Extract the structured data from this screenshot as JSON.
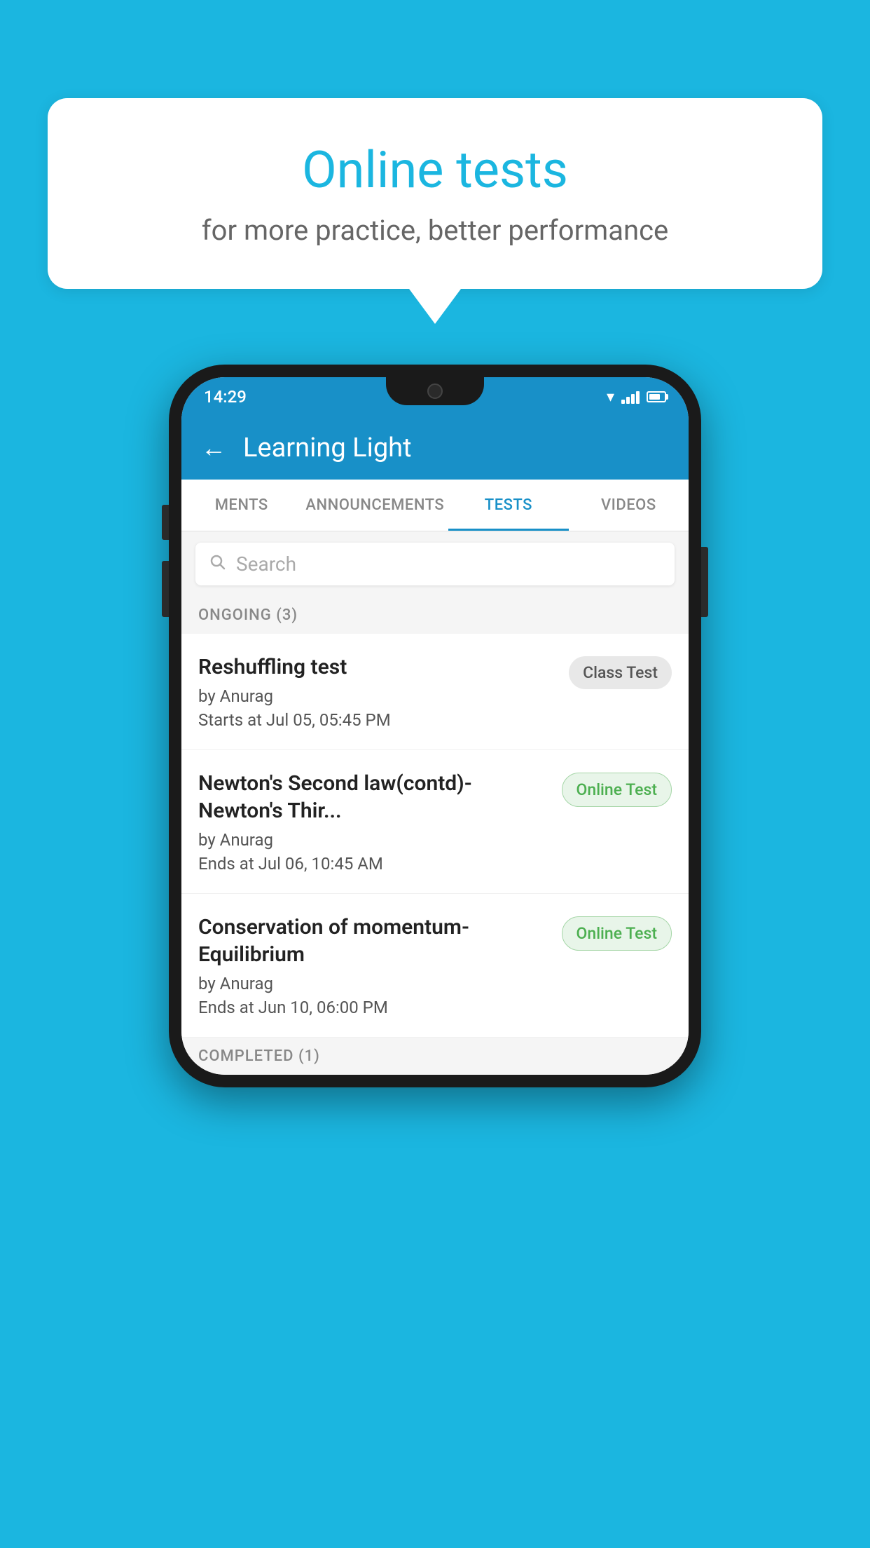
{
  "background_color": "#1BB6E0",
  "bubble": {
    "title": "Online tests",
    "subtitle": "for more practice, better performance"
  },
  "phone": {
    "status_bar": {
      "time": "14:29"
    },
    "header": {
      "title": "Learning Light",
      "back_label": "←"
    },
    "tabs": [
      {
        "id": "ments",
        "label": "MENTS",
        "active": false
      },
      {
        "id": "announcements",
        "label": "ANNOUNCEMENTS",
        "active": false
      },
      {
        "id": "tests",
        "label": "TESTS",
        "active": true
      },
      {
        "id": "videos",
        "label": "VIDEOS",
        "active": false
      }
    ],
    "search": {
      "placeholder": "Search"
    },
    "ongoing_section": {
      "label": "ONGOING (3)"
    },
    "tests": [
      {
        "id": 1,
        "title": "Reshuffling test",
        "author": "by Anurag",
        "date": "Starts at  Jul 05, 05:45 PM",
        "badge": "Class Test",
        "badge_type": "class"
      },
      {
        "id": 2,
        "title": "Newton's Second law(contd)-Newton's Thir...",
        "author": "by Anurag",
        "date": "Ends at  Jul 06, 10:45 AM",
        "badge": "Online Test",
        "badge_type": "online"
      },
      {
        "id": 3,
        "title": "Conservation of momentum-Equilibrium",
        "author": "by Anurag",
        "date": "Ends at  Jun 10, 06:00 PM",
        "badge": "Online Test",
        "badge_type": "online"
      }
    ],
    "completed_section": {
      "label": "COMPLETED (1)"
    }
  }
}
